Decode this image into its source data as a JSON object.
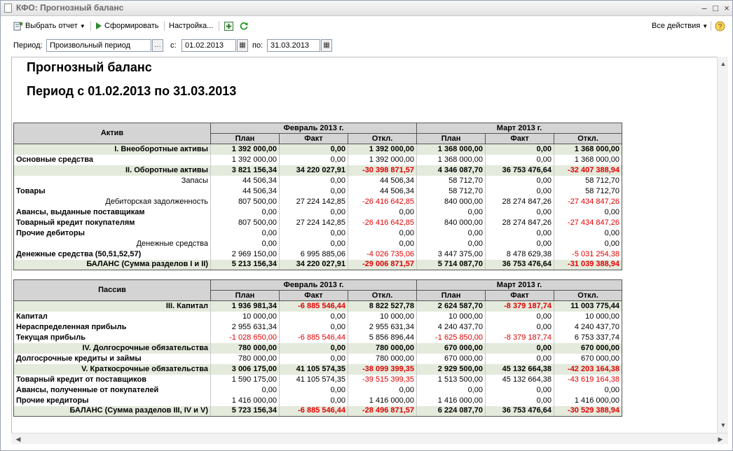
{
  "window": {
    "title": "КФО: Прогнозный баланс"
  },
  "toolbar": {
    "choose_report": "Выбрать отчет",
    "generate": "Сформировать",
    "settings": "Настройка...",
    "all_actions": "Все действия"
  },
  "period": {
    "label": "Период:",
    "value": "Произвольный период",
    "from_label": "с:",
    "from": "01.02.2013",
    "to_label": "по:",
    "to": "31.03.2013"
  },
  "report": {
    "title": "Прогнозный баланс",
    "subtitle": "Период с 01.02.2013 по 31.03.2013"
  },
  "columns": {
    "feb": "Февраль 2013 г.",
    "mar": "Март 2013 г.",
    "plan": "План",
    "fact": "Факт",
    "dev": "Откл."
  },
  "assets": {
    "header": "Актив",
    "rows": [
      {
        "label": "I. Внеоборотные активы",
        "align": "right",
        "style": "section",
        "v": [
          "1 392 000,00",
          "0,00",
          "1 392 000,00",
          "1 368 000,00",
          "0,00",
          "1 368 000,00"
        ]
      },
      {
        "label": "Основные средства",
        "align": "left",
        "style": "boldlabel",
        "v": [
          "1 392 000,00",
          "0,00",
          "1 392 000,00",
          "1 368 000,00",
          "0,00",
          "1 368 000,00"
        ]
      },
      {
        "label": "II. Оборотные активы",
        "align": "right",
        "style": "section",
        "v": [
          "3 821 156,34",
          "34 220 027,91",
          "-30 398 871,57",
          "4 346 087,70",
          "36 753 476,64",
          "-32 407 388,94"
        ]
      },
      {
        "label": "Запасы",
        "align": "right",
        "style": "normal",
        "v": [
          "44 506,34",
          "0,00",
          "44 506,34",
          "58 712,70",
          "0,00",
          "58 712,70"
        ]
      },
      {
        "label": "Товары",
        "align": "left",
        "style": "boldlabel",
        "v": [
          "44 506,34",
          "0,00",
          "44 506,34",
          "58 712,70",
          "0,00",
          "58 712,70"
        ]
      },
      {
        "label": "Дебиторская задолженность",
        "align": "right",
        "style": "normal",
        "v": [
          "807 500,00",
          "27 224 142,85",
          "-26 416 642,85",
          "840 000,00",
          "28 274 847,26",
          "-27 434 847,26"
        ]
      },
      {
        "label": "Авансы, выданные поставщикам",
        "align": "left",
        "style": "boldlabel",
        "v": [
          "0,00",
          "0,00",
          "0,00",
          "0,00",
          "0,00",
          "0,00"
        ]
      },
      {
        "label": "Товарный кредит покупателям",
        "align": "left",
        "style": "boldlabel",
        "v": [
          "807 500,00",
          "27 224 142,85",
          "-26 416 642,85",
          "840 000,00",
          "28 274 847,26",
          "-27 434 847,26"
        ]
      },
      {
        "label": "Прочие дебиторы",
        "align": "left",
        "style": "boldlabel",
        "v": [
          "0,00",
          "0,00",
          "0,00",
          "0,00",
          "0,00",
          "0,00"
        ]
      },
      {
        "label": "Денежные средства",
        "align": "right",
        "style": "normal",
        "v": [
          "0,00",
          "0,00",
          "0,00",
          "0,00",
          "0,00",
          "0,00"
        ]
      },
      {
        "label": "Денежные средства (50,51,52,57)",
        "align": "left",
        "style": "boldlabel",
        "v": [
          "2 969 150,00",
          "6 995 885,06",
          "-4 026 735,06",
          "3 447 375,00",
          "8 478 629,38",
          "-5 031 254,38"
        ]
      },
      {
        "label": "БАЛАНС (Сумма разделов I и II)",
        "align": "right",
        "style": "total",
        "v": [
          "5 213 156,34",
          "34 220 027,91",
          "-29 006 871,57",
          "5 714 087,70",
          "36 753 476,64",
          "-31 039 388,94"
        ]
      }
    ]
  },
  "liabilities": {
    "header": "Пассив",
    "rows": [
      {
        "label": "III. Капитал",
        "align": "right",
        "style": "section",
        "v": [
          "1 936 981,34",
          "-6 885 546,44",
          "8 822 527,78",
          "2 624 587,70",
          "-8 379 187,74",
          "11 003 775,44"
        ]
      },
      {
        "label": "Капитал",
        "align": "left",
        "style": "boldlabel",
        "v": [
          "10 000,00",
          "0,00",
          "10 000,00",
          "10 000,00",
          "0,00",
          "10 000,00"
        ]
      },
      {
        "label": "Нераспределенная прибыль",
        "align": "left",
        "style": "boldlabel",
        "v": [
          "2 955 631,34",
          "0,00",
          "2 955 631,34",
          "4 240 437,70",
          "0,00",
          "4 240 437,70"
        ]
      },
      {
        "label": "Текущая прибыль",
        "align": "left",
        "style": "boldlabel",
        "v": [
          "-1 028 650,00",
          "-6 885 546,44",
          "5 856 896,44",
          "-1 625 850,00",
          "-8 379 187,74",
          "6 753 337,74"
        ]
      },
      {
        "label": "IV. Долгосрочные обязательства",
        "align": "right",
        "style": "section",
        "v": [
          "780 000,00",
          "0,00",
          "780 000,00",
          "670 000,00",
          "0,00",
          "670 000,00"
        ]
      },
      {
        "label": "Долгосрочные кредиты и займы",
        "align": "left",
        "style": "boldlabel",
        "v": [
          "780 000,00",
          "0,00",
          "780 000,00",
          "670 000,00",
          "0,00",
          "670 000,00"
        ]
      },
      {
        "label": "V. Краткосрочные обязательства",
        "align": "right",
        "style": "section",
        "v": [
          "3 006 175,00",
          "41 105 574,35",
          "-38 099 399,35",
          "2 929 500,00",
          "45 132 664,38",
          "-42 203 164,38"
        ]
      },
      {
        "label": "Товарный кредит от поставщиков",
        "align": "left",
        "style": "boldlabel",
        "v": [
          "1 590 175,00",
          "41 105 574,35",
          "-39 515 399,35",
          "1 513 500,00",
          "45 132 664,38",
          "-43 619 164,38"
        ]
      },
      {
        "label": "Авансы, полученные от покупателей",
        "align": "left",
        "style": "boldlabel",
        "v": [
          "0,00",
          "0,00",
          "0,00",
          "0,00",
          "0,00",
          "0,00"
        ]
      },
      {
        "label": "Прочие кредиторы",
        "align": "left",
        "style": "boldlabel",
        "v": [
          "1 416 000,00",
          "0,00",
          "1 416 000,00",
          "1 416 000,00",
          "0,00",
          "1 416 000,00"
        ]
      },
      {
        "label": "БАЛАНС (Сумма разделов III, IV и V)",
        "align": "right",
        "style": "total",
        "v": [
          "5 723 156,34",
          "-6 885 546,44",
          "-28 496 871,57",
          "6 224 087,70",
          "36 753 476,64",
          "-30 529 388,94"
        ]
      }
    ]
  },
  "icons": {
    "report": "report-icon",
    "run": "play-icon",
    "add": "add-icon",
    "refresh": "refresh-icon",
    "help": "help-icon",
    "calendar": "calendar-icon"
  },
  "colors": {
    "negative": "#e00000",
    "header_bg": "#d4d4d4",
    "section_bg": "#e4eadc"
  }
}
